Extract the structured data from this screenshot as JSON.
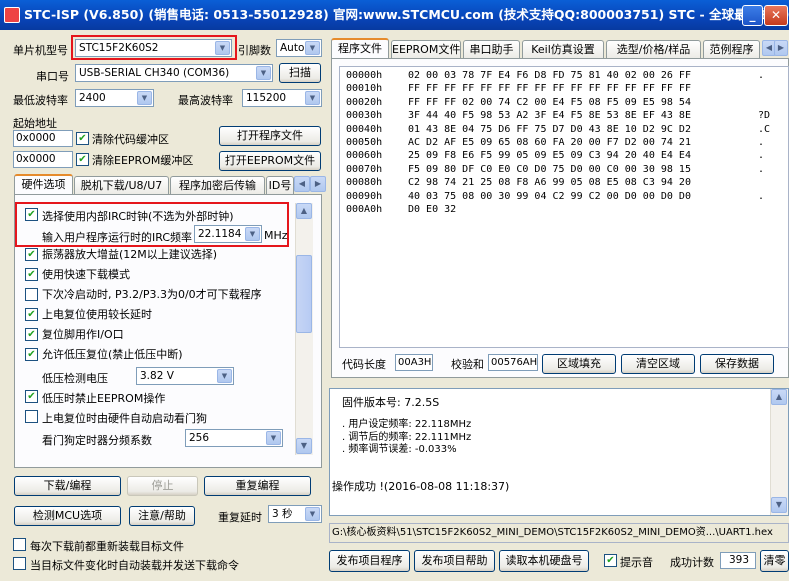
{
  "window": {
    "title": "STC-ISP (V6.850) (销售电话: 0513-55012928) 官网:www.STCMCU.com  (技术支持QQ:800003751)  STC - 全球最大的8051单片机设计公司"
  },
  "left": {
    "mcu_label": "单片机型号",
    "mcu_value": "STC15F2K60S2",
    "pins_label": "引脚数",
    "pins_value": "Auto",
    "port_label": "串口号",
    "port_value": "USB-SERIAL CH340 (COM36)",
    "scan_label": "扫描",
    "min_baud_label": "最低波特率",
    "min_baud_value": "2400",
    "max_baud_label": "最高波特率",
    "max_baud_value": "115200",
    "start_addr_label": "起始地址",
    "addr1": "0x0000",
    "clear_code": "清除代码缓冲区",
    "open_prog": "打开程序文件",
    "addr2": "0x0000",
    "clear_eeprom": "清除EEPROM缓冲区",
    "open_eeprom": "打开EEPROM文件"
  },
  "hw_tabs": [
    "硬件选项",
    "脱机下载/U8/U7",
    "程序加密后传输",
    "ID号"
  ],
  "hw": {
    "opt_irc": "选择使用内部IRC时钟(不选为外部时钟)",
    "irc_label": "输入用户程序运行时的IRC频率",
    "irc_value": "22.1184",
    "irc_unit": "MHz",
    "options": [
      {
        "label": "振荡器放大增益(12M以上建议选择)",
        "checked": true
      },
      {
        "label": "使用快速下载模式",
        "checked": true
      },
      {
        "label": "下次冷启动时, P3.2/P3.3为0/0才可下载程序",
        "checked": false
      },
      {
        "label": "上电复位使用较长延时",
        "checked": true
      },
      {
        "label": "复位脚用作I/O口",
        "checked": true
      },
      {
        "label": "允许低压复位(禁止低压中断)",
        "checked": true
      }
    ],
    "lv_label": "低压检测电压",
    "lv_value": "3.82 V",
    "opt_eeprom": "低压时禁止EEPROM操作",
    "opt_wdt": "上电复位时由硬件自动启动看门狗",
    "wdt_label": "看门狗定时器分频系数",
    "wdt_value": "256"
  },
  "actions": {
    "download": "下载/编程",
    "stop": "停止",
    "reprogram": "重复编程",
    "check_mcu": "检测MCU选项",
    "help": "注意/帮助",
    "repeat_delay_label": "重复延时",
    "repeat_delay_value": "3 秒",
    "reload_each": "每次下载前都重新装载目标文件",
    "auto_load": "当目标文件变化时自动装载并发送下载命令"
  },
  "right_tabs": [
    "程序文件",
    "EEPROM文件",
    "串口助手",
    "Keil仿真设置",
    "选型/价格/样品",
    "范例程序"
  ],
  "hex": {
    "addresses": [
      "00000h",
      "00010h",
      "00020h",
      "00030h",
      "00040h",
      "00050h",
      "00060h",
      "00070h",
      "00080h",
      "00090h",
      "000A0h"
    ],
    "rows": [
      "02 00 03 78 7F E4 F6 D8 FD 75 81 40 02 00 26 FF",
      "FF FF FF FF FF FF FF FF FF FF FF FF FF FF FF FF",
      "FF FF FF 02 00 74 C2 00 E4 F5 08 F5 09 E5 98 54",
      "3F 44 40 F5 98 53 A2 3F E4 F5 8E 53 8E EF 43 8E",
      "01 43 8E 04 75 D6 FF 75 D7 D0 43 8E 10 D2 9C D2",
      "AC D2 AF E5 09 65 08 60 FA 20 00 F7 D2 00 74 21",
      "25 09 F8 E6 F5 99 05 09 E5 09 C3 94 20 40 E4 E4",
      "F5 09 80 DF C0 E0 C0 D0 75 D0 00 C0 00 30 98 15",
      "C2 98 74 21 25 08 F8 A6 99 05 08 E5 08 C3 94 20",
      "40 03 75 08 00 30 99 04 C2 99 C2 00 D0 00 D0 D0",
      "D0 E0 32"
    ],
    "ascii": [
      ".",
      "",
      "",
      "?D",
      ".C",
      ". ",
      ".",
      ".",
      "",
      ".",
      ""
    ]
  },
  "code_len_label": "代码长度",
  "code_len_value": "00A3H",
  "checksum_label": "校验和",
  "checksum_value": "00576AH",
  "fill_btn": "区域填充",
  "clear_btn": "清空区域",
  "save_btn": "保存数据",
  "log": {
    "fw": "固件版本号: 7.2.5S",
    "lines": [
      ". 用户设定频率: 22.118MHz",
      ". 调节后的频率: 22.111MHz",
      ". 频率调节误差: -0.033%"
    ],
    "result": "操作成功 !(2016-08-08 11:18:37)"
  },
  "path": "G:\\核心板资料\\51\\STC15F2K60S2_MINI_DEMO\\STC15F2K60S2_MINI_DEMO资...\\UART1.hex",
  "bottom": {
    "publish_prog": "发布项目程序",
    "publish_help": "发布项目帮助",
    "read_disk": "读取本机硬盘号",
    "beep": "提示音",
    "success_label": "成功计数",
    "success_value": "393",
    "clear": "清零"
  }
}
